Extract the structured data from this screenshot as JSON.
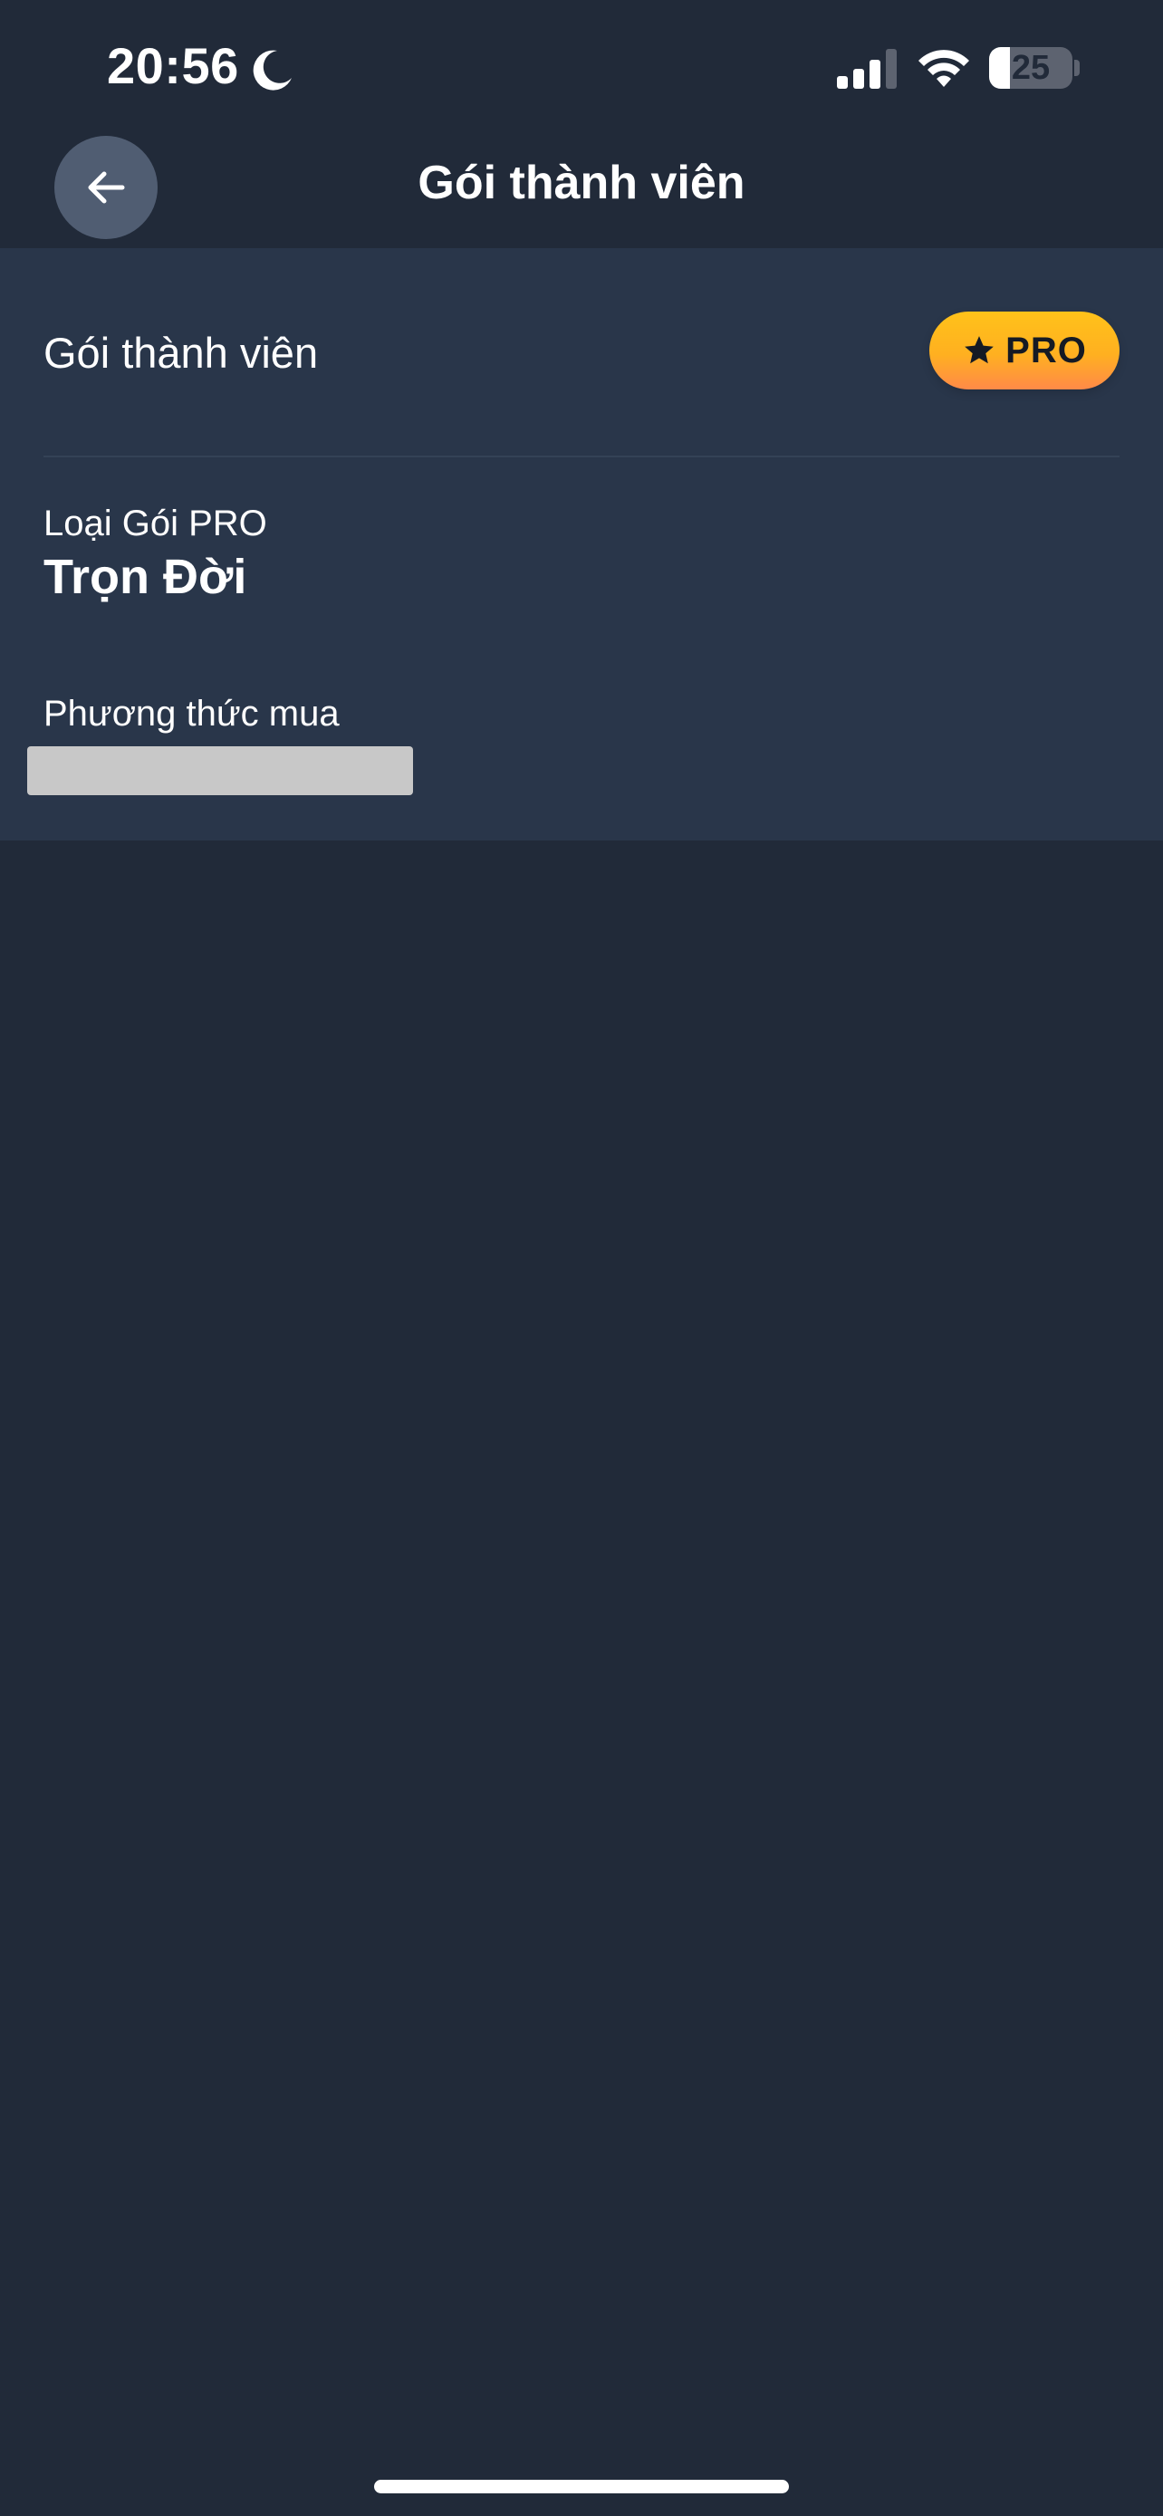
{
  "status_bar": {
    "time": "20:56",
    "battery_level": "25",
    "battery_fraction": 0.25,
    "icons": [
      "moon-icon",
      "signal-icon",
      "wifi-icon",
      "battery-icon"
    ]
  },
  "header": {
    "title": "Gói thành viên",
    "back_icon": "arrow-left-icon"
  },
  "membership": {
    "label": "Gói thành viên",
    "badge_label": "PRO",
    "badge_icon": "star-icon",
    "plan_type_label": "Loại Gói PRO",
    "plan_type_value": "Trọn Đời",
    "purchase_method_label": "Phương thức mua"
  },
  "colors": {
    "background": "#212a39",
    "card": "#29364a",
    "back_button": "#505d72",
    "badge_top": "#ffc21a",
    "badge_bottom": "#ff8a48",
    "redaction": "#c8c8c8"
  }
}
